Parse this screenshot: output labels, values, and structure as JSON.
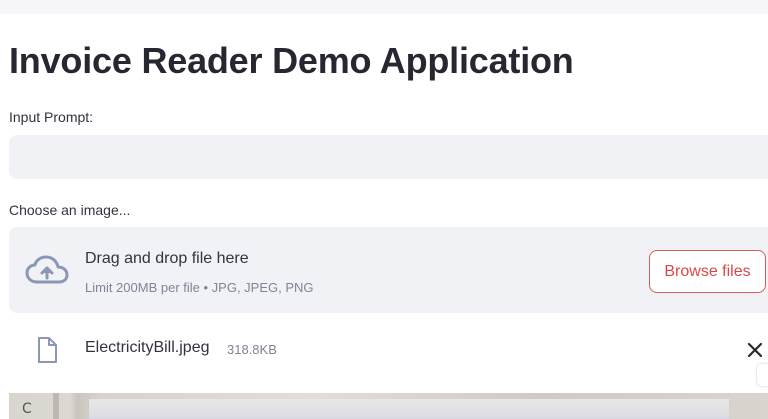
{
  "header": {
    "title": "Invoice Reader Demo Application"
  },
  "prompt": {
    "label": "Input Prompt:",
    "value": "",
    "placeholder": ""
  },
  "uploader": {
    "label": "Choose an image...",
    "drag_text": "Drag and drop file here",
    "limit_text": "Limit 200MB per file • JPG, JPEG, PNG",
    "browse_label": "Browse files",
    "icon": "cloud-upload-icon"
  },
  "uploaded_file": {
    "name": "ElectricityBill.jpeg",
    "size": "318.8KB",
    "icon": "file-icon",
    "remove_icon": "close-icon"
  },
  "preview": {
    "visible_letter": "C"
  },
  "colors": {
    "accent": "#d94848",
    "input_bg": "#f0f2f6",
    "text": "#31333f",
    "muted": "#808495",
    "icon": "#8a98b4"
  }
}
